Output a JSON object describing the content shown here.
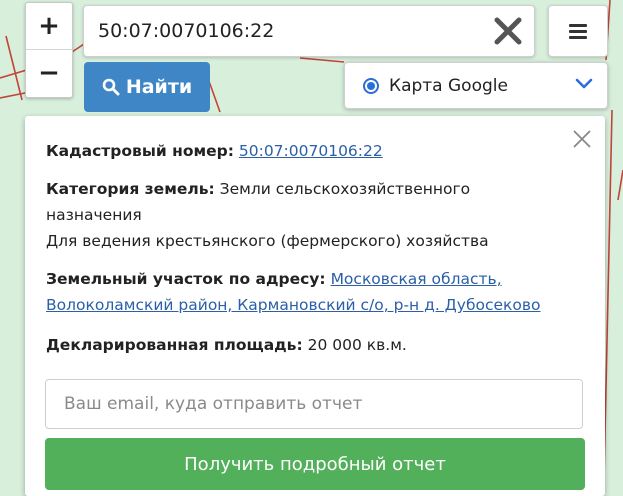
{
  "map": {
    "background_color": "#d8efdc",
    "boundary_color": "#c0453a"
  },
  "zoom": {
    "in_label": "+",
    "out_label": "−"
  },
  "search": {
    "value": "50:07:0070106:22",
    "clear_icon": "close-x-icon"
  },
  "menu": {
    "icon": "hamburger-menu-icon"
  },
  "find_button": {
    "label": "Найти",
    "icon": "search-icon",
    "color": "#3f86c6"
  },
  "layer": {
    "selected": "Карта Google",
    "icon": "chevron-down-icon"
  },
  "info": {
    "cadastral_label": "Кадастровый номер:",
    "cadastral_value": "50:07:0070106:22",
    "category_label": "Категория земель:",
    "category_value_line1": "Земли сельскохозяйственного",
    "category_value_line2": "назначения",
    "usage": "Для ведения крестьянского (фермерского) хозяйства",
    "address_label": "Земельный участок по адресу:",
    "address_value_line1": "Московская область,",
    "address_value_line2": "Волоколамский район, Кармановский с/о, р-н д. Дубосеково",
    "area_label": "Декларированная площадь:",
    "area_value": "20 000 кв.м."
  },
  "email": {
    "placeholder": "Ваш email, куда отправить отчет"
  },
  "report_button": {
    "label": "Получить подробный отчет",
    "color": "#52b05a"
  }
}
